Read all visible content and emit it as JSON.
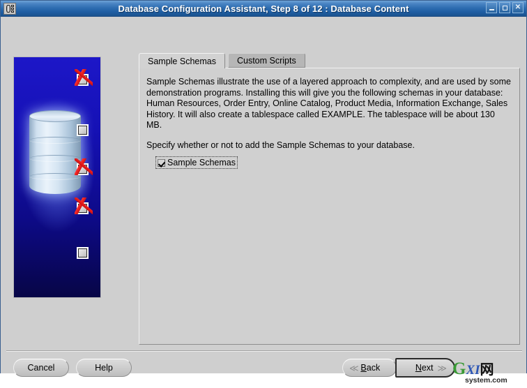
{
  "window": {
    "title": "Database Configuration Assistant, Step 8 of 12 : Database Content",
    "app_icon": "database-icon",
    "controls": {
      "minimize": "minimize-icon",
      "maximize": "maximize-icon",
      "close": "✕"
    }
  },
  "illustration": {
    "name": "database-wizard-illustration",
    "markers": [
      {
        "state": "checked"
      },
      {
        "state": "unchecked"
      },
      {
        "state": "checked"
      },
      {
        "state": "checked"
      },
      {
        "state": "unchecked"
      }
    ]
  },
  "tabs": [
    {
      "label": "Sample Schemas",
      "active": true
    },
    {
      "label": "Custom Scripts",
      "active": false
    }
  ],
  "content": {
    "paragraph1": "Sample Schemas illustrate the use of a layered approach to complexity, and are used by some demonstration programs. Installing this will give you the following schemas in your database: Human Resources, Order Entry, Online Catalog, Product Media, Information Exchange, Sales History. It will also create a tablespace called EXAMPLE. The tablespace will be about 130 MB.",
    "paragraph2": "Specify whether or not to add the Sample Schemas to your database.",
    "checkbox": {
      "label": "Sample Schemas",
      "checked": true,
      "focused": true
    }
  },
  "buttons": {
    "cancel": "Cancel",
    "help": "Help",
    "back": {
      "label": "Back",
      "mnemonic": "B",
      "icon": "≪"
    },
    "next": {
      "label": "Next",
      "mnemonic": "N",
      "icon": "≫",
      "focused": true
    }
  },
  "watermark": {
    "g": "G",
    "xi": "XI",
    "cn": "网",
    "sub": "system.com"
  },
  "colors": {
    "titlebar_blue": "#2d6cb0",
    "panel_gray": "#d0d0d0",
    "window_gray": "#cfcfcf",
    "art_blue": "#1511b5",
    "check_red": "#ee2222"
  }
}
